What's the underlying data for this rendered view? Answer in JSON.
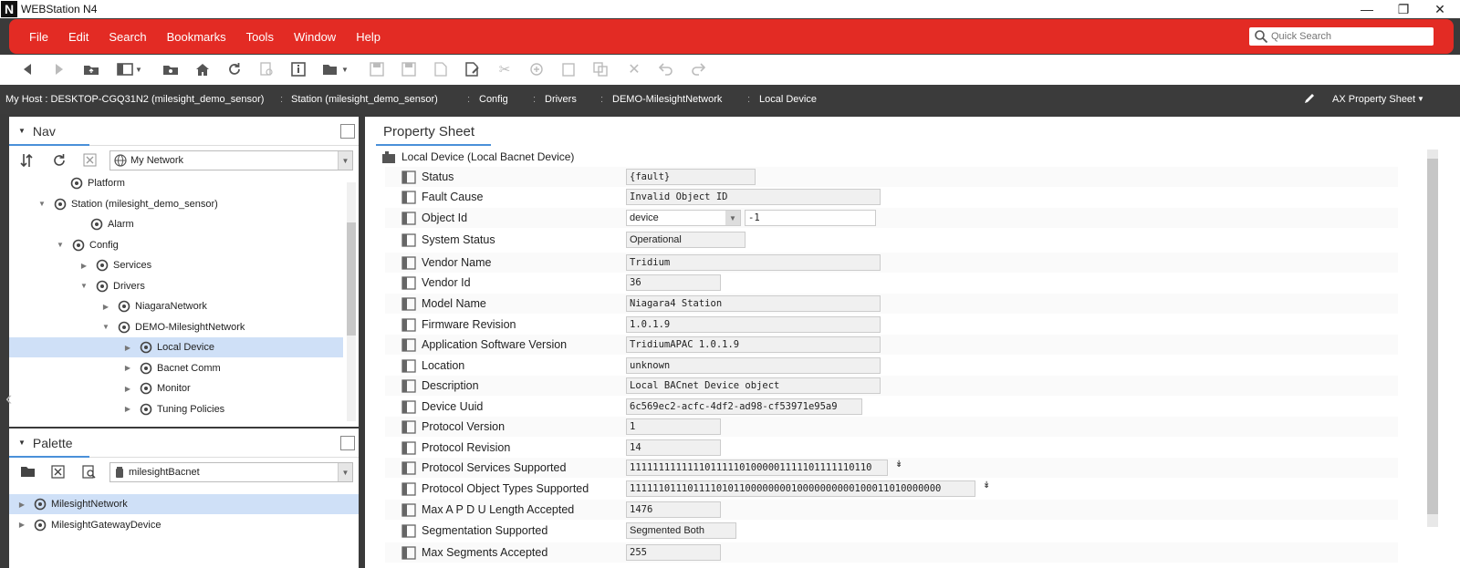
{
  "window": {
    "title": "WEBStation N4",
    "logo": "N"
  },
  "menu": [
    "File",
    "Edit",
    "Search",
    "Bookmarks",
    "Tools",
    "Window",
    "Help"
  ],
  "quick_search": {
    "placeholder": "Quick Search"
  },
  "path": {
    "crumbs": [
      "My Host : DESKTOP-CGQ31N2 (milesight_demo_sensor)",
      "Station (milesight_demo_sensor)",
      "Config",
      "Drivers",
      "DEMO-MilesightNetwork",
      "Local Device"
    ],
    "view": "AX Property Sheet"
  },
  "nav": {
    "title": "Nav",
    "network_combo": "My Network",
    "tree": [
      {
        "label": "Platform",
        "icon": "platform-icon",
        "exp": ""
      },
      {
        "label": "Station (milesight_demo_sensor)",
        "icon": "station-icon",
        "exp": "▼"
      },
      {
        "label": "Alarm",
        "icon": "bell-icon",
        "exp": ""
      },
      {
        "label": "Config",
        "icon": "config-icon",
        "exp": "▼"
      },
      {
        "label": "Services",
        "icon": "services-icon",
        "exp": "▶"
      },
      {
        "label": "Drivers",
        "icon": "drivers-icon",
        "exp": "▼"
      },
      {
        "label": "NiagaraNetwork",
        "icon": "network-icon",
        "exp": "▶"
      },
      {
        "label": "DEMO-MilesightNetwork",
        "icon": "network-icon",
        "exp": "▼"
      },
      {
        "label": "Local Device",
        "icon": "device-icon",
        "exp": "▶"
      },
      {
        "label": "Bacnet Comm",
        "icon": "comm-icon",
        "exp": "▶"
      },
      {
        "label": "Monitor",
        "icon": "monitor-icon",
        "exp": "▶"
      },
      {
        "label": "Tuning Policies",
        "icon": "tuning-icon",
        "exp": "▶"
      }
    ]
  },
  "palette": {
    "title": "Palette",
    "module_combo": "milesightBacnet",
    "items": [
      {
        "label": "MilesightNetwork",
        "icon": "network-icon"
      },
      {
        "label": "MilesightGatewayDevice",
        "icon": "gateway-icon"
      }
    ]
  },
  "property_sheet": {
    "tab": "Property Sheet",
    "root_label": "Local Device  (Local Bacnet Device)",
    "object_id_type": "device",
    "rows": [
      {
        "label": "Status",
        "value": "{fault}",
        "w": 142,
        "style": "mono"
      },
      {
        "label": "Fault Cause",
        "value": "Invalid Object ID",
        "w": 279,
        "style": "mono"
      },
      {
        "label": "Object Id",
        "value": "-1",
        "w": 0,
        "style": "objid"
      },
      {
        "label": "System Status",
        "value": "Operational",
        "w": 131,
        "style": "sans"
      },
      {
        "label": "Vendor Name",
        "value": "Tridium",
        "w": 279,
        "style": "mono"
      },
      {
        "label": "Vendor Id",
        "value": "36",
        "w": 104,
        "style": "mono"
      },
      {
        "label": "Model Name",
        "value": "Niagara4 Station",
        "w": 279,
        "style": "mono"
      },
      {
        "label": "Firmware Revision",
        "value": "1.0.1.9",
        "w": 279,
        "style": "mono"
      },
      {
        "label": "Application Software Version",
        "value": "TridiumAPAC 1.0.1.9",
        "w": 279,
        "style": "mono"
      },
      {
        "label": "Location",
        "value": "unknown",
        "w": 279,
        "style": "mono"
      },
      {
        "label": "Description",
        "value": "Local BACnet Device object",
        "w": 279,
        "style": "mono"
      },
      {
        "label": "Device Uuid",
        "value": "6c569ec2-acfc-4df2-ad98-cf53971e95a9",
        "w": 259,
        "style": "mono"
      },
      {
        "label": "Protocol Version",
        "value": "1",
        "w": 104,
        "style": "mono"
      },
      {
        "label": "Protocol Revision",
        "value": "14",
        "w": 104,
        "style": "mono"
      },
      {
        "label": "Protocol Services Supported",
        "value": "111111111111101111101000001111101111110110",
        "w": 287,
        "style": "mono",
        "dd": "↡"
      },
      {
        "label": "Protocol Object Types Supported",
        "value": "111111011101111010110000000010000000000100011010000000",
        "w": 383,
        "style": "mono",
        "dd": "↡"
      },
      {
        "label": "Max A P D U Length Accepted",
        "value": "1476",
        "w": 104,
        "style": "mono"
      },
      {
        "label": "Segmentation Supported",
        "value": "Segmented Both",
        "w": 121,
        "style": "sans"
      },
      {
        "label": "Max Segments Accepted",
        "value": "255",
        "w": 104,
        "style": "mono"
      }
    ]
  }
}
